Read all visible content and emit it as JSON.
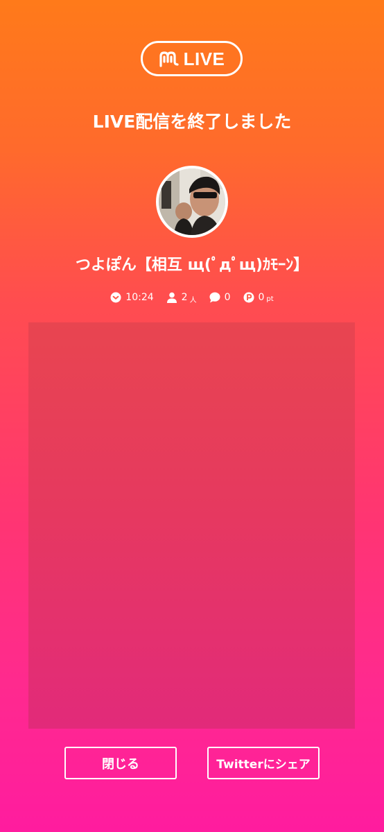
{
  "logo": {
    "icon": "m-logo-icon",
    "text": "LIVE"
  },
  "heading": "LIVE配信を終了しました",
  "broadcaster": {
    "avatar": "broadcaster-photo",
    "name": "つよぽん【相互 щ(ﾟдﾟщ)ｶﾓｰﾝ】"
  },
  "stats": {
    "duration": {
      "icon": "clock-icon",
      "value": "10:24"
    },
    "viewers": {
      "icon": "person-icon",
      "value": "2",
      "unit": "人"
    },
    "comments": {
      "icon": "speech-bubble-icon",
      "value": "0"
    },
    "points": {
      "icon": "point-coin-icon",
      "value": "0",
      "unit": "pt"
    }
  },
  "buttons": {
    "close_label": "閉じる",
    "share_label": "Twitterにシェア"
  },
  "colors": {
    "gradient_top": "#ff7a1a",
    "gradient_bottom": "#ff1c9f",
    "panel_top": "#e84550",
    "panel_bottom": "#e22a7a",
    "foreground": "#ffffff"
  }
}
